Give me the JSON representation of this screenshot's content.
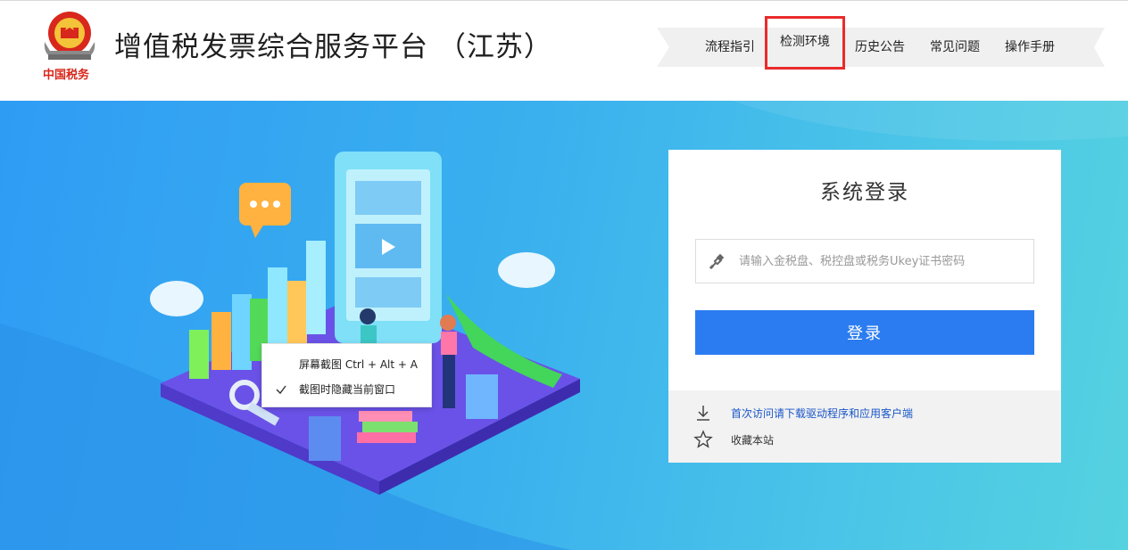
{
  "header": {
    "emblem_text": "中国税务",
    "title": "增值税发票综合服务平台 （江苏）"
  },
  "nav": {
    "items": [
      {
        "label": "流程指引"
      },
      {
        "label": "检测环境"
      },
      {
        "label": "历史公告"
      },
      {
        "label": "常见问题"
      },
      {
        "label": "操作手册"
      }
    ],
    "highlighted_index": 1
  },
  "context_menu": {
    "items": [
      {
        "label": "屏幕截图 Ctrl + Alt + A",
        "checked": false
      },
      {
        "label": "截图时隐藏当前窗口",
        "checked": true
      }
    ]
  },
  "login": {
    "title": "系统登录",
    "password_placeholder": "请输入金税盘、税控盘或税务Ukey证书密码",
    "password_value": "",
    "button_label": "登录",
    "download_link": "首次访问请下载驱动程序和应用客户端",
    "favorite_label": "收藏本站"
  },
  "colors": {
    "primary": "#2b7cf0",
    "highlight_border": "#ea2b2b",
    "link": "#1a56c8",
    "hero_start": "#2f9cf4",
    "hero_end": "#55d2e0"
  },
  "icons": {
    "emblem": "national-emblem-icon",
    "password": "key-icon",
    "download": "download-icon",
    "favorite": "star-icon",
    "check": "check-icon"
  }
}
